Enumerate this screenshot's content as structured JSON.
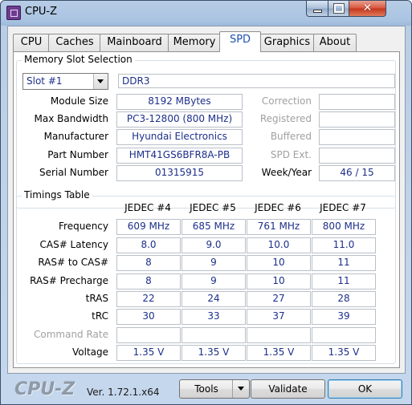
{
  "window": {
    "title": "CPU-Z"
  },
  "tabs": [
    "CPU",
    "Caches",
    "Mainboard",
    "Memory",
    "SPD",
    "Graphics",
    "About"
  ],
  "active_tab": "SPD",
  "memory_slot": {
    "group_title": "Memory Slot Selection",
    "slot_selected": "Slot #1",
    "memory_type": "DDR3",
    "labels": {
      "module_size": "Module Size",
      "max_bandwidth": "Max Bandwidth",
      "manufacturer": "Manufacturer",
      "part_number": "Part Number",
      "serial_number": "Serial Number",
      "correction": "Correction",
      "registered": "Registered",
      "buffered": "Buffered",
      "spd_ext": "SPD Ext.",
      "week_year": "Week/Year"
    },
    "values": {
      "module_size": "8192 MBytes",
      "max_bandwidth": "PC3-12800 (800 MHz)",
      "manufacturer": "Hyundai Electronics",
      "part_number": "HMT41GS6BFR8A-PB",
      "serial_number": "01315915",
      "correction": "",
      "registered": "",
      "buffered": "",
      "spd_ext": "",
      "week_year": "46 / 15"
    }
  },
  "timings": {
    "group_title": "Timings Table",
    "columns": [
      "JEDEC #4",
      "JEDEC #5",
      "JEDEC #6",
      "JEDEC #7"
    ],
    "rows": [
      {
        "label": "Frequency",
        "values": [
          "609 MHz",
          "685 MHz",
          "761 MHz",
          "800 MHz"
        ]
      },
      {
        "label": "CAS# Latency",
        "values": [
          "8.0",
          "9.0",
          "10.0",
          "11.0"
        ]
      },
      {
        "label": "RAS# to CAS#",
        "values": [
          "8",
          "9",
          "10",
          "11"
        ]
      },
      {
        "label": "RAS# Precharge",
        "values": [
          "8",
          "9",
          "10",
          "11"
        ]
      },
      {
        "label": "tRAS",
        "values": [
          "22",
          "24",
          "27",
          "28"
        ]
      },
      {
        "label": "tRC",
        "values": [
          "30",
          "33",
          "37",
          "39"
        ]
      },
      {
        "label": "Command Rate",
        "values": [
          "",
          "",
          "",
          ""
        ]
      },
      {
        "label": "Voltage",
        "values": [
          "1.35 V",
          "1.35 V",
          "1.35 V",
          "1.35 V"
        ]
      }
    ]
  },
  "footer": {
    "brand": "CPU-Z",
    "version": "Ver. 1.72.1.x64",
    "tools_label": "Tools",
    "validate_label": "Validate",
    "ok_label": "OK"
  }
}
